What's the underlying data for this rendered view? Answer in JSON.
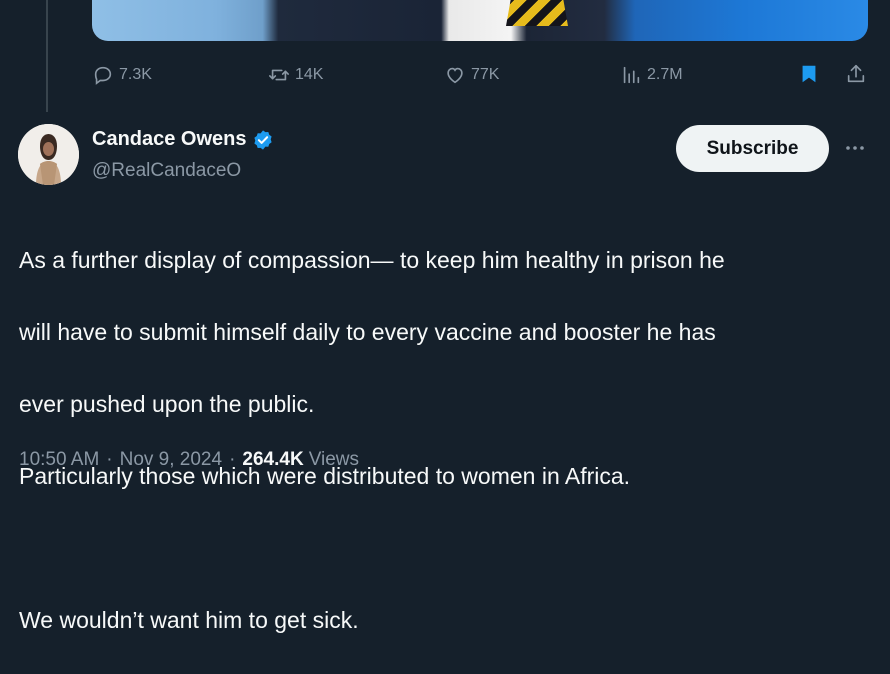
{
  "previous_tweet": {
    "stats": {
      "replies": "7.3K",
      "reposts": "14K",
      "likes": "77K",
      "views": "2.7M"
    }
  },
  "tweet": {
    "author": {
      "name": "Candace Owens",
      "handle": "@RealCandaceO",
      "verified": true
    },
    "subscribe_label": "Subscribe",
    "text_lines": [
      "As a further display of compassion— to keep him healthy in prison he",
      "will have to submit himself daily to every vaccine and booster he has",
      "ever pushed upon the public.",
      "Particularly those which were distributed to women in Africa.",
      "",
      "We wouldn’t want him to get sick."
    ],
    "time": "10:50 AM",
    "date": "Nov 9, 2024",
    "views_count": "264.4K",
    "views_label": "Views"
  },
  "icons": [
    "reply-icon",
    "repost-icon",
    "like-icon",
    "views-icon",
    "bookmark-icon",
    "share-icon",
    "verified-badge-icon",
    "more-icon"
  ],
  "colors": {
    "background": "#15202b",
    "text": "#f7f9f9",
    "muted": "#8b98a5",
    "accent": "#1d9bf0",
    "button_bg": "#eff3f4"
  }
}
